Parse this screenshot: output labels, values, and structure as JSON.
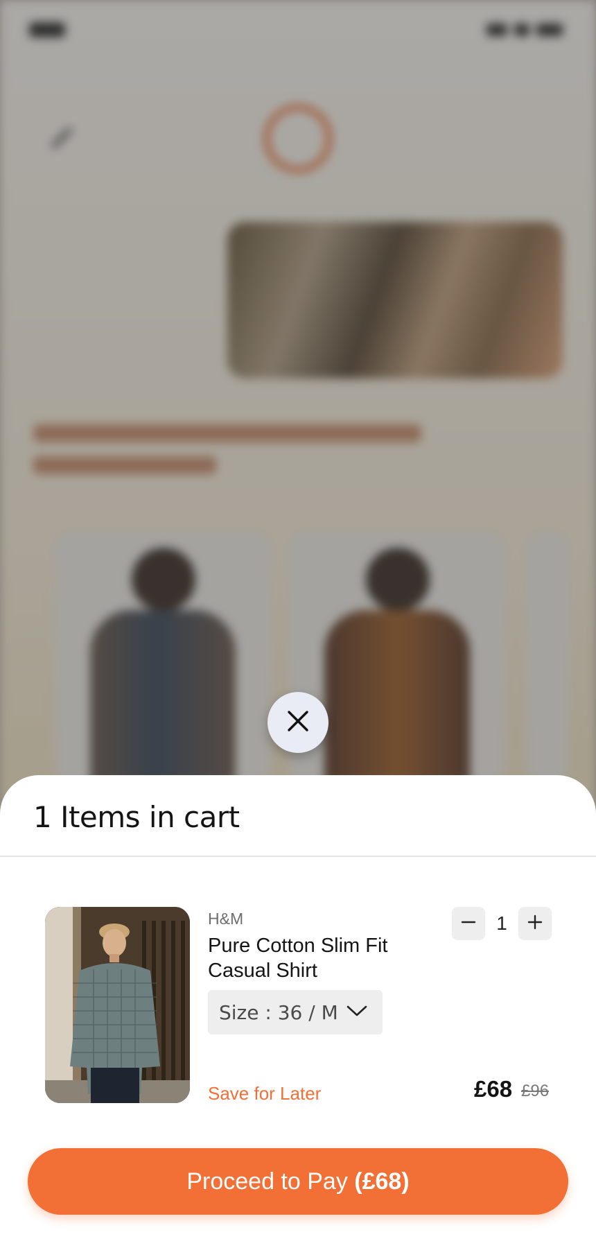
{
  "cart": {
    "title": "1 Items in cart"
  },
  "item": {
    "brand": "H&M",
    "name": "Pure Cotton Slim Fit Casual Shirt",
    "size_label": "Size : 36 / M",
    "quantity": "1",
    "price": "£68",
    "original_price": "£96",
    "save_for_later": "Save for Later"
  },
  "checkout": {
    "label": "Proceed to Pay ",
    "amount": "(£68)"
  },
  "icons": {
    "close": "close-icon",
    "chevron": "chevron-down-icon",
    "minus": "minus-icon",
    "plus": "plus-icon"
  },
  "colors": {
    "accent": "#f26f36",
    "sheet_background": "#ffffff",
    "stepper_background": "#eeeeee"
  }
}
